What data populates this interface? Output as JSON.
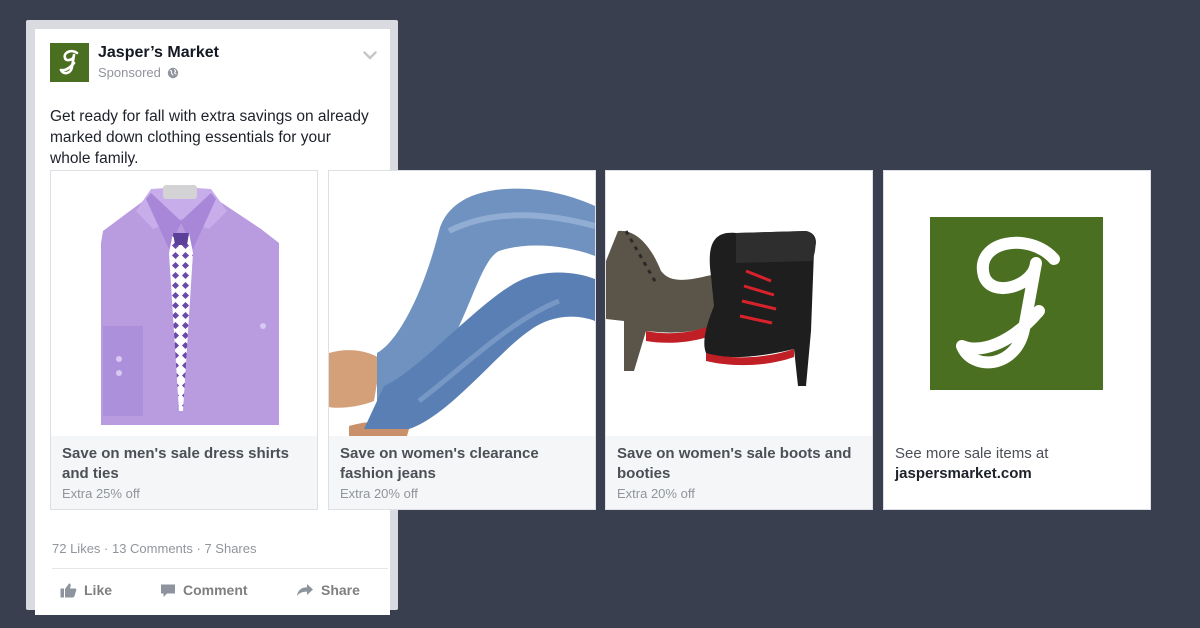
{
  "post": {
    "page_name": "Jasper’s Market",
    "sponsored": "Sponsored",
    "text": "Get ready for fall with extra savings on already marked down clothing essentials for your whole family.",
    "logo_letter": "J",
    "brand_color": "#4a6f20"
  },
  "cards": [
    {
      "title": "Save on men's sale dress shirts and ties",
      "subtitle": "Extra 25% off",
      "image": "purple dress shirt with tie"
    },
    {
      "title": "Save on women's clearance fashion jeans",
      "subtitle": "Extra 20% off",
      "image": "legs in blue jeans"
    },
    {
      "title": "Save on women's sale boots and booties",
      "subtitle": "Extra 20% off",
      "image": "pair of boots"
    },
    {
      "title_line1": "See more sale items at",
      "title_line2": "jaspersmarket.com",
      "image": "Jasper's Market logo"
    }
  ],
  "engagement": {
    "stats": "72 Likes · 13 Comments · 7 Shares",
    "like_label": "Like",
    "comment_label": "Comment",
    "share_label": "Share"
  },
  "icons": [
    "globe-icon",
    "chevron-down-icon",
    "like-icon",
    "comment-icon",
    "share-icon"
  ]
}
